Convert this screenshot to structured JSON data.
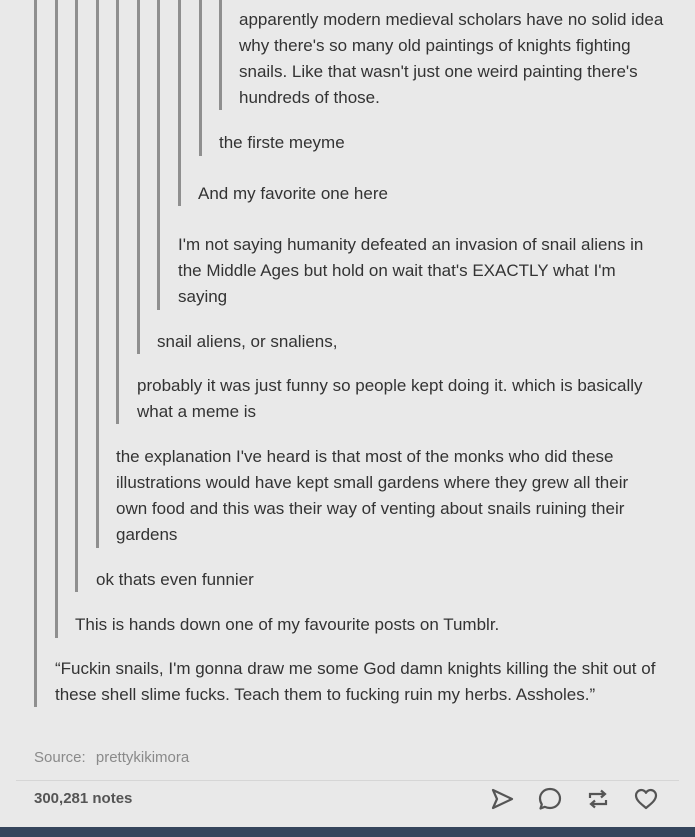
{
  "thread": [
    {
      "text": "apparently modern medieval scholars have no solid idea why there's so many old paintings of knights fighting snails.  Like that wasn't just one weird painting there's hundreds of those."
    },
    {
      "text": "the firste meyme"
    },
    {
      "text": "And my favorite one here"
    },
    {
      "text": "I'm not saying humanity defeated an invasion of snail aliens in the Middle Ages but hold on wait that's EXACTLY what I'm saying"
    },
    {
      "text": "snail aliens, or snaliens,"
    },
    {
      "text": "probably it was just funny so people kept doing it. which is basically what a meme is"
    },
    {
      "text": "the explanation I've heard is that most of the monks who did these illustrations would have kept small gardens where they grew all their own food and this was their way of venting about snails ruining their gardens"
    },
    {
      "text": "ok thats even funnier"
    },
    {
      "text": "This is hands down one of my favourite posts on Tumblr."
    },
    {
      "text": "“Fuckin snails, I'm gonna draw me some God damn knights killing the shit out of these shell slime fucks. Teach them to fucking ruin my herbs. Assholes.”"
    }
  ],
  "footer": {
    "source_label": "Source:",
    "source_value": "prettykikimora",
    "notes": "300,281 notes"
  },
  "actions": {
    "share_icon": "share-arrow-icon",
    "reply_icon": "reply-bubble-icon",
    "reblog_icon": "reblog-icon",
    "like_icon": "heart-icon"
  }
}
